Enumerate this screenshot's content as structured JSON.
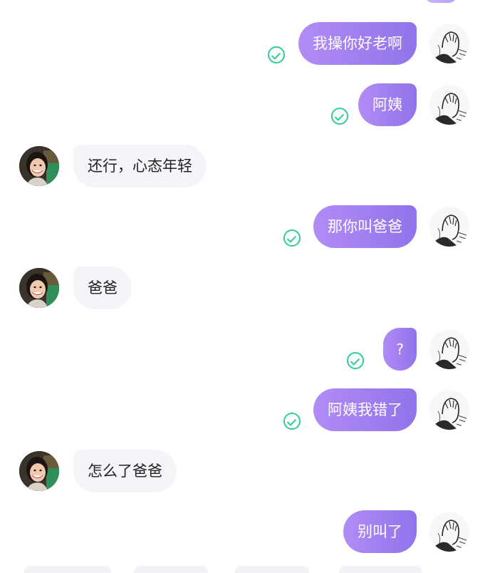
{
  "conversation": {
    "messages": [
      {
        "sender": "me",
        "text": "我操你好老啊",
        "read": true
      },
      {
        "sender": "me",
        "text": "阿姨",
        "read": true
      },
      {
        "sender": "peer",
        "text": "还行，心态年轻"
      },
      {
        "sender": "me",
        "text": "那你叫爸爸",
        "read": true
      },
      {
        "sender": "peer",
        "text": "爸爸"
      },
      {
        "sender": "me",
        "text": "?",
        "read": true
      },
      {
        "sender": "me",
        "text": "阿姨我错了",
        "read": true
      },
      {
        "sender": "peer",
        "text": "怎么了爸爸"
      },
      {
        "sender": "me",
        "text": "别叫了",
        "read": false
      }
    ]
  },
  "colors": {
    "my_bubble_gradient": [
      "#b08cf5",
      "#8f74ea"
    ],
    "peer_bubble": "#f4f5f8",
    "read_check": "#2fcf8f",
    "background": "#ffffff"
  },
  "icons": {
    "read_receipt": "check-circle-icon",
    "my_avatar": "manga-sketch-avatar",
    "peer_avatar": "woman-photo-avatar"
  }
}
